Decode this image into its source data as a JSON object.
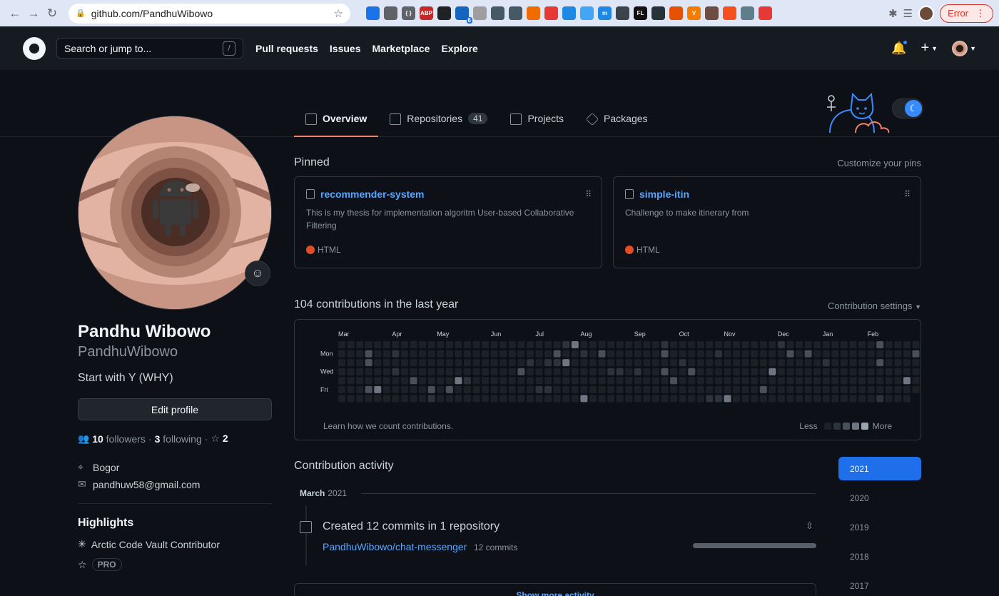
{
  "browser": {
    "url": "github.com/PandhuWibowo",
    "error_label": "Error",
    "extension_badge": "6",
    "extensions": [
      {
        "name": "screen-capture-icon",
        "color": "#1a73e8",
        "label": ""
      },
      {
        "name": "grid-extension-icon",
        "color": "#5f6368",
        "label": ""
      },
      {
        "name": "code-extension-icon",
        "color": "#5f6368",
        "label": "{ }"
      },
      {
        "name": "adblock-plus-icon",
        "color": "#c62828",
        "label": "ABP"
      },
      {
        "name": "circle-extension-icon",
        "color": "#202124",
        "label": ""
      },
      {
        "name": "shield-extension-icon",
        "color": "#1565c0",
        "label": ""
      },
      {
        "name": "gear-extension-icon",
        "color": "#9e9e9e",
        "label": ""
      },
      {
        "name": "crop-extension-icon",
        "color": "#455a64",
        "label": ""
      },
      {
        "name": "move-extension-icon",
        "color": "#455a64",
        "label": ""
      },
      {
        "name": "globe-extension-icon",
        "color": "#ef6c00",
        "label": ""
      },
      {
        "name": "calendar-extension-icon",
        "color": "#e53935",
        "label": ""
      },
      {
        "name": "earth-extension-icon",
        "color": "#1e88e5",
        "label": ""
      },
      {
        "name": "refresh-extension-icon",
        "color": "#42a5f5",
        "label": ""
      },
      {
        "name": "m-extension-icon",
        "color": "#1e88e5",
        "label": "m"
      },
      {
        "name": "wordpress-extension-icon",
        "color": "#3c434a",
        "label": ""
      },
      {
        "name": "fl-extension-icon",
        "color": "#111111",
        "label": "FL"
      },
      {
        "name": "dots-extension-icon",
        "color": "#263238",
        "label": ""
      },
      {
        "name": "square-extension-icon",
        "color": "#e65100",
        "label": ""
      },
      {
        "name": "v-extension-icon",
        "color": "#f57c00",
        "label": "V"
      },
      {
        "name": "lens-extension-icon",
        "color": "#6d4c41",
        "label": ""
      },
      {
        "name": "orange-extension-icon",
        "color": "#f4511e",
        "label": ""
      },
      {
        "name": "bag-extension-icon",
        "color": "#607d8b",
        "label": ""
      },
      {
        "name": "video-extension-icon",
        "color": "#e53935",
        "label": ""
      }
    ]
  },
  "header": {
    "search_placeholder": "Search or jump to...",
    "search_shortcut": "/",
    "nav": [
      "Pull requests",
      "Issues",
      "Marketplace",
      "Explore"
    ],
    "plus": "+"
  },
  "tabs": [
    {
      "label": "Overview",
      "count": null,
      "active": true
    },
    {
      "label": "Repositories",
      "count": "41",
      "active": false
    },
    {
      "label": "Projects",
      "count": null,
      "active": false
    },
    {
      "label": "Packages",
      "count": null,
      "active": false
    }
  ],
  "profile": {
    "name": "Pandhu Wibowo",
    "login": "PandhuWibowo",
    "bio": "Start with Y (WHY)",
    "edit_button": "Edit profile",
    "followers_count": "10",
    "followers_label": "followers",
    "separator": "·",
    "following_count": "3",
    "following_label": "following",
    "stars_count": "2",
    "location": "Bogor",
    "email": "pandhuw58@gmail.com",
    "highlights_title": "Highlights",
    "highlights": [
      "Arctic Code Vault Contributor"
    ],
    "pro_badge": "PRO"
  },
  "pinned": {
    "title": "Pinned",
    "customize_link": "Customize your pins",
    "repos": [
      {
        "name": "recommender-system",
        "description": "This is my thesis for implementation algoritm User-based Collaborative Filtering",
        "language": "HTML",
        "language_color": "#e34c26"
      },
      {
        "name": "simple-itin",
        "description": "Challenge to make itinerary from",
        "language": "HTML",
        "language_color": "#e34c26"
      }
    ]
  },
  "contributions": {
    "title": "104 contributions in the last year",
    "settings_link": "Contribution settings",
    "months": [
      "Mar",
      "Apr",
      "May",
      "Jun",
      "Jul",
      "Aug",
      "Sep",
      "Oct",
      "Nov",
      "Dec",
      "Jan",
      "Feb"
    ],
    "weekdays": [
      "Mon",
      "Wed",
      "Fri"
    ],
    "learn_link": "Learn how we count contributions.",
    "legend_less": "Less",
    "legend_more": "More",
    "levels": [
      "#1c2128",
      "#2d333b",
      "#4a5058",
      "#6e7681",
      "#9aa4af"
    ]
  },
  "activity": {
    "title": "Contribution activity",
    "month": "March",
    "year": "2021",
    "event_title": "Created 12 commits in 1 repository",
    "repo": "PandhuWibowo/chat-messenger",
    "commits": "12 commits",
    "commit_share": 1,
    "show_more": "Show more activity"
  },
  "years": [
    "2021",
    "2020",
    "2019",
    "2018",
    "2017"
  ],
  "active_year": "2021"
}
